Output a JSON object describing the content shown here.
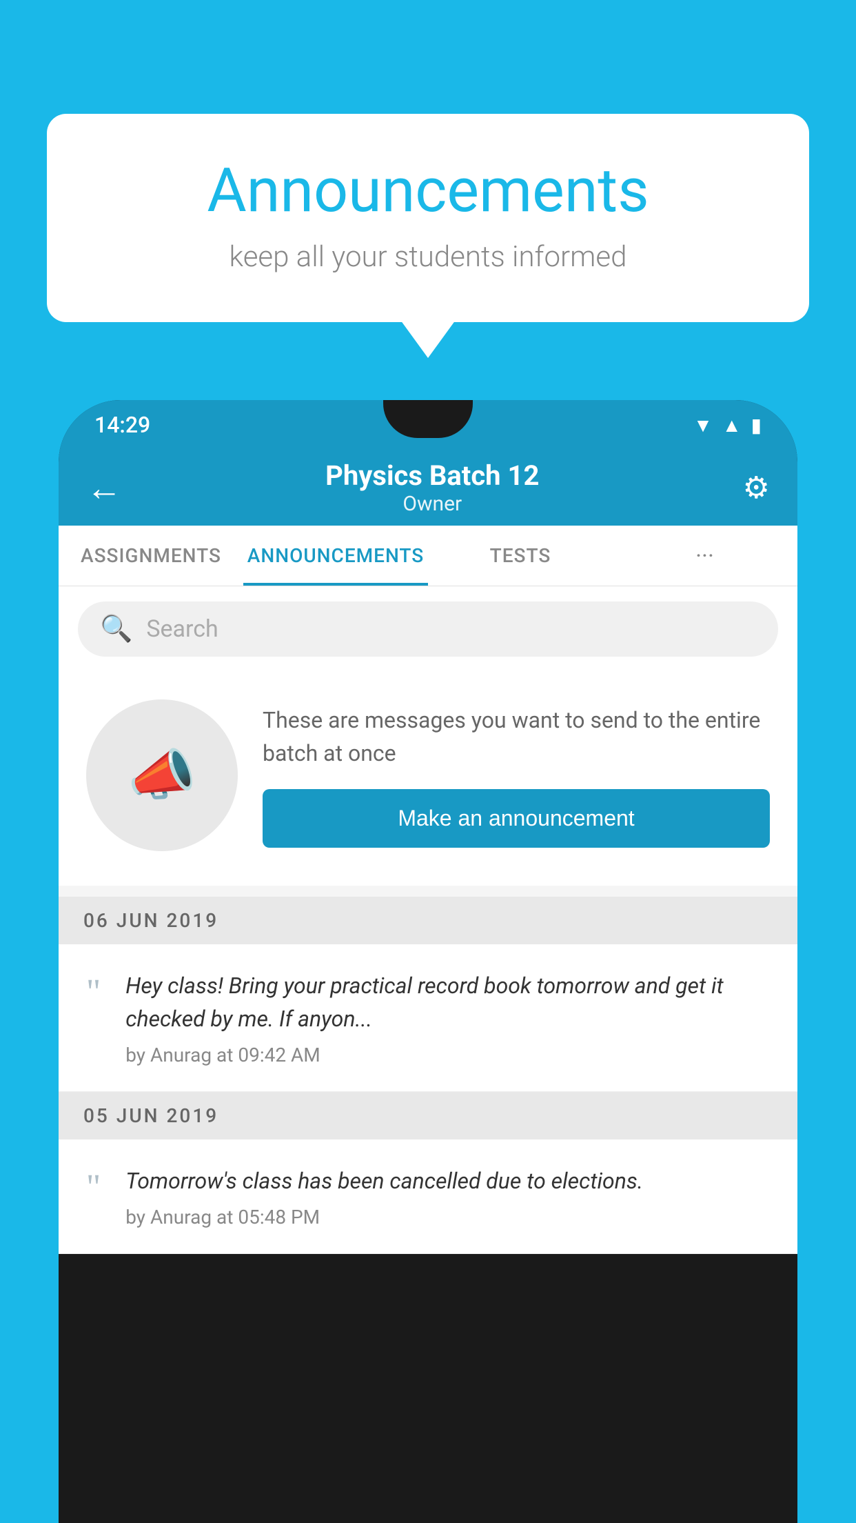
{
  "background_color": "#1ab8e8",
  "speech_bubble": {
    "title": "Announcements",
    "subtitle": "keep all your students informed"
  },
  "status_bar": {
    "time": "14:29",
    "icons": [
      "wifi",
      "signal",
      "battery"
    ]
  },
  "app_bar": {
    "title": "Physics Batch 12",
    "subtitle": "Owner",
    "back_label": "←",
    "settings_label": "⚙"
  },
  "tabs": [
    {
      "label": "ASSIGNMENTS",
      "active": false
    },
    {
      "label": "ANNOUNCEMENTS",
      "active": true
    },
    {
      "label": "TESTS",
      "active": false
    },
    {
      "label": "···",
      "active": false
    }
  ],
  "search": {
    "placeholder": "Search"
  },
  "promo": {
    "description_text": "These are messages you want to send to the entire batch at once",
    "button_label": "Make an announcement"
  },
  "announcements": [
    {
      "date": "06  JUN  2019",
      "message": "Hey class! Bring your practical record book tomorrow and get it checked by me. If anyon...",
      "meta": "by Anurag at 09:42 AM"
    },
    {
      "date": "05  JUN  2019",
      "message": "Tomorrow's class has been cancelled due to elections.",
      "meta": "by Anurag at 05:48 PM"
    }
  ]
}
